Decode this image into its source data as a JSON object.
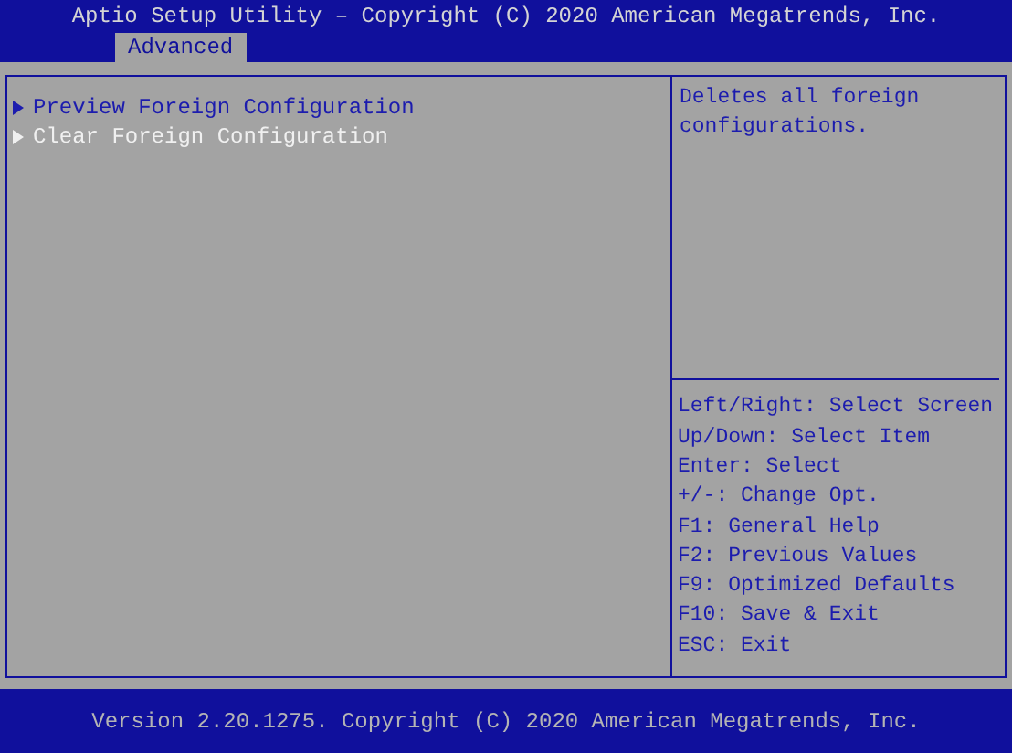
{
  "title": "Aptio Setup Utility – Copyright (C) 2020 American Megatrends, Inc.",
  "tabs": [
    {
      "label": "Advanced",
      "selected": true
    }
  ],
  "menu_items": [
    {
      "label": "Preview Foreign Configuration",
      "selected": false
    },
    {
      "label": "Clear Foreign Configuration",
      "selected": true
    }
  ],
  "help_text": "Deletes all foreign configurations.",
  "key_help": [
    "Left/Right: Select Screen",
    "Up/Down: Select Item",
    "Enter: Select",
    "+/-: Change Opt.",
    "F1: General Help",
    "F2: Previous Values",
    "F9: Optimized Defaults",
    "F10: Save & Exit",
    "ESC: Exit"
  ],
  "footer": "Version 2.20.1275. Copyright (C) 2020 American Megatrends, Inc."
}
